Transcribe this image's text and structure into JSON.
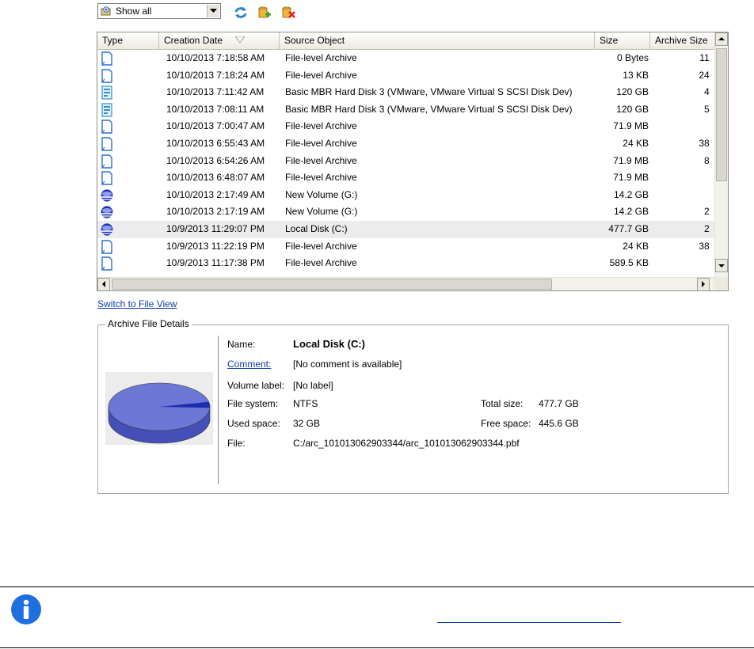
{
  "toolbar": {
    "filter_value": "Show all",
    "buttons": [
      "refresh-icon",
      "add-archive-icon",
      "delete-archive-icon"
    ]
  },
  "list": {
    "columns": [
      "Type",
      "Creation Date",
      "Source Object",
      "Size",
      "Archive Size"
    ],
    "sorted_by": "Creation Date",
    "rows": [
      {
        "icon": "file-icon",
        "date": "10/10/2013 7:18:58 AM",
        "source": "File-level Archive",
        "size": "0 Bytes",
        "archive": "11 "
      },
      {
        "icon": "file-icon",
        "date": "10/10/2013 7:18:24 AM",
        "source": "File-level Archive",
        "size": "13 KB",
        "archive": "24 "
      },
      {
        "icon": "disk-file-icon",
        "date": "10/10/2013 7:11:42 AM",
        "source": "Basic MBR Hard Disk 3 (VMware, VMware Virtual S SCSI Disk Dev)",
        "size": "120 GB",
        "archive": "4 "
      },
      {
        "icon": "disk-file-icon",
        "date": "10/10/2013 7:08:11 AM",
        "source": "Basic MBR Hard Disk 3 (VMware, VMware Virtual S SCSI Disk Dev)",
        "size": "120 GB",
        "archive": "5 "
      },
      {
        "icon": "file-icon",
        "date": "10/10/2013 7:00:47 AM",
        "source": "File-level Archive",
        "size": "71.9 MB",
        "archive": ""
      },
      {
        "icon": "file-icon",
        "date": "10/10/2013 6:55:43 AM",
        "source": "File-level Archive",
        "size": "24 KB",
        "archive": "38 "
      },
      {
        "icon": "file-icon",
        "date": "10/10/2013 6:54:26 AM",
        "source": "File-level Archive",
        "size": "71.9 MB",
        "archive": "8 "
      },
      {
        "icon": "file-icon",
        "date": "10/10/2013 6:48:07 AM",
        "source": "File-level Archive",
        "size": "71.9 MB",
        "archive": ""
      },
      {
        "icon": "volume-icon",
        "date": "10/10/2013 2:17:49 AM",
        "source": "New Volume (G:)",
        "size": "14.2 GB",
        "archive": ""
      },
      {
        "icon": "volume-icon",
        "date": "10/10/2013 2:17:19 AM",
        "source": "New Volume (G:)",
        "size": "14.2 GB",
        "archive": "2 "
      },
      {
        "icon": "volume-icon",
        "date": "10/9/2013 11:29:07 PM",
        "source": "Local Disk (C:)",
        "size": "477.7 GB",
        "archive": "2 ",
        "selected": true
      },
      {
        "icon": "file-icon",
        "date": "10/9/2013 11:22:19 PM",
        "source": "File-level Archive",
        "size": "24 KB",
        "archive": "38 "
      },
      {
        "icon": "file-icon",
        "date": "10/9/2013 11:17:38 PM",
        "source": "File-level Archive",
        "size": "589.5 KB",
        "archive": ""
      }
    ]
  },
  "switch_link": "Switch to File View",
  "details": {
    "group_title": "Archive File Details",
    "name_label": "Name:",
    "name_value": "Local Disk (C:)",
    "comment_label": "Comment:",
    "comment_value": "[No comment is available]",
    "volume_label_label": "Volume label:",
    "volume_label_value": "[No label]",
    "fs_label": "File system:",
    "fs_value": "NTFS",
    "total_label": "Total size:",
    "total_value": "477.7 GB",
    "used_label": "Used space:",
    "used_value": "32 GB",
    "free_label": "Free space:",
    "free_value": "445.6 GB",
    "file_label": "File:",
    "file_value": "C:/arc_101013062903344/arc_101013062903344.pbf",
    "used_fraction": 0.067
  },
  "colors": {
    "link": "#0d3ea8",
    "pie_free": "#6d78d6",
    "pie_used": "#1c2bb0",
    "note_icon": "#1e6fe0"
  }
}
